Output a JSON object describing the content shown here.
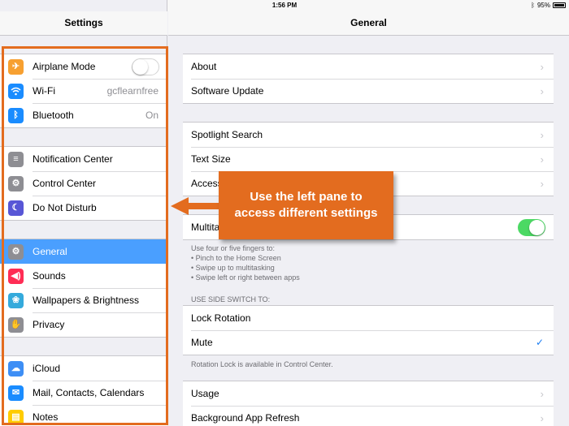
{
  "status_bar": {
    "device": "iPad",
    "time": "1:56 PM",
    "battery": "95%"
  },
  "left_pane": {
    "title": "Settings",
    "groups": [
      {
        "items": [
          {
            "label": "Airplane Mode",
            "icon": "airplane-icon",
            "color": "#f7a031",
            "toggle": "off"
          },
          {
            "label": "Wi-Fi",
            "icon": "wifi-icon",
            "color": "#1a8cff",
            "value": "gcflearnfree"
          },
          {
            "label": "Bluetooth",
            "icon": "bluetooth-icon",
            "color": "#1a8cff",
            "value": "On"
          }
        ]
      },
      {
        "items": [
          {
            "label": "Notification Center",
            "icon": "notification-center-icon",
            "color": "#8e8e93"
          },
          {
            "label": "Control Center",
            "icon": "control-center-icon",
            "color": "#8e8e93"
          },
          {
            "label": "Do Not Disturb",
            "icon": "moon-icon",
            "color": "#5856d6"
          }
        ]
      },
      {
        "items": [
          {
            "label": "General",
            "icon": "gear-icon",
            "color": "#8e8e93",
            "selected": true
          },
          {
            "label": "Sounds",
            "icon": "speaker-icon",
            "color": "#ff2d55"
          },
          {
            "label": "Wallpapers & Brightness",
            "icon": "flower-icon",
            "color": "#34aadc"
          },
          {
            "label": "Privacy",
            "icon": "hand-icon",
            "color": "#8e8e93"
          }
        ]
      },
      {
        "items": [
          {
            "label": "iCloud",
            "icon": "cloud-icon",
            "color": "#3d8ef5"
          },
          {
            "label": "Mail, Contacts, Calendars",
            "icon": "mail-icon",
            "color": "#1a8cff"
          },
          {
            "label": "Notes",
            "icon": "notes-icon",
            "color": "#ffcc00"
          }
        ]
      }
    ]
  },
  "right_pane": {
    "title": "General",
    "group1": [
      "About",
      "Software Update"
    ],
    "group2": [
      "Spotlight Search",
      "Text Size",
      "Access"
    ],
    "multitasking_label": "Multita",
    "multitasking_toggle": "on",
    "multitasking_note": [
      "Use four or five fingers to:",
      "• Pinch to the Home Screen",
      "• Swipe up to multitasking",
      "• Swipe left or right between apps"
    ],
    "side_switch_header": "USE SIDE SWITCH TO:",
    "side_switch": [
      "Lock Rotation",
      "Mute"
    ],
    "side_switch_note": "Rotation Lock is available in Control Center.",
    "group5": [
      "Usage",
      "Background App Refresh"
    ]
  },
  "callout": {
    "line1": "Use the left pane to",
    "line2": "access different settings"
  },
  "colors": {
    "accent": "#e36c1f",
    "selected": "#4a9fff",
    "toggle_on": "#4cd964"
  }
}
